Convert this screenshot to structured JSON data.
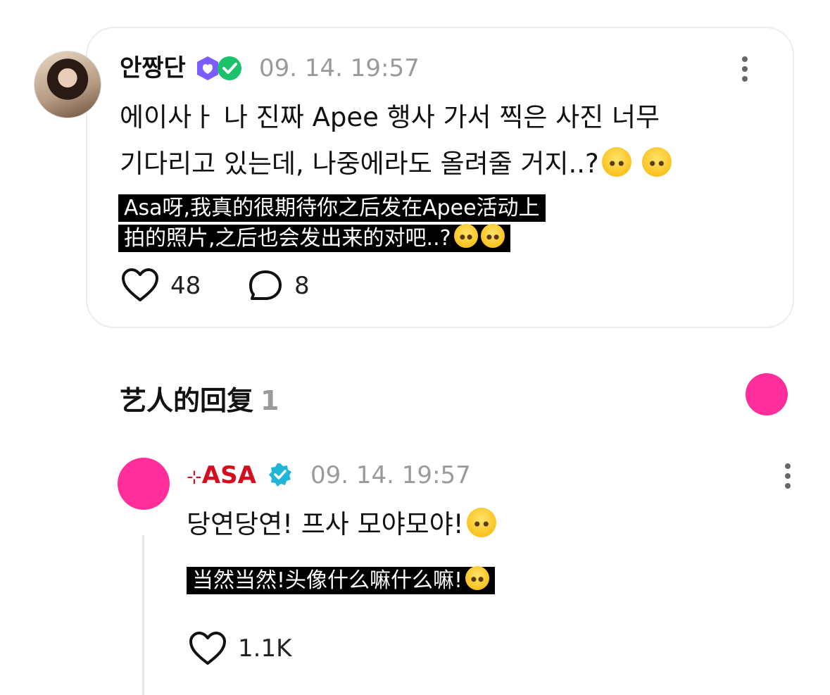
{
  "post": {
    "username": "안짱단",
    "timestamp": "09. 14. 19:57",
    "text_line1": "에이사ㅏ 나 진짜 Apee 행사 가서 찍은 사진 너무",
    "text_line2": "기다리고 있는데, 나중에라도 올려줄 거지..?",
    "translation_line1": "Asa呀,我真的很期待你之后发在Apee活动上",
    "translation_line2": "拍的照片,之后也会发出来的对吧..?",
    "likes": "48",
    "comments": "8",
    "icons": [
      "verified-badge-icon",
      "check-badge-icon",
      "more-icon",
      "heart-icon",
      "comment-icon",
      "pleading-face-emoji"
    ]
  },
  "replies_section": {
    "title": "艺人的回复",
    "count": "1"
  },
  "reply": {
    "username_prefix": "⊹",
    "username": "ASA",
    "timestamp": "09. 14. 19:57",
    "text": "당연당연! 프사 모야모야!",
    "translation": "当然当然!头像什么嘛什么嘛!",
    "likes": "1.1K",
    "icons": [
      "verified-badge-icon",
      "more-icon",
      "heart-icon",
      "pleading-face-emoji"
    ]
  },
  "colors": {
    "accent_pink": "#ff2e9a",
    "artist_name": "#d40d1f",
    "verified_blue": "#1fb6d8",
    "badge_purple": "#7a5cff",
    "badge_green": "#19c26b"
  }
}
